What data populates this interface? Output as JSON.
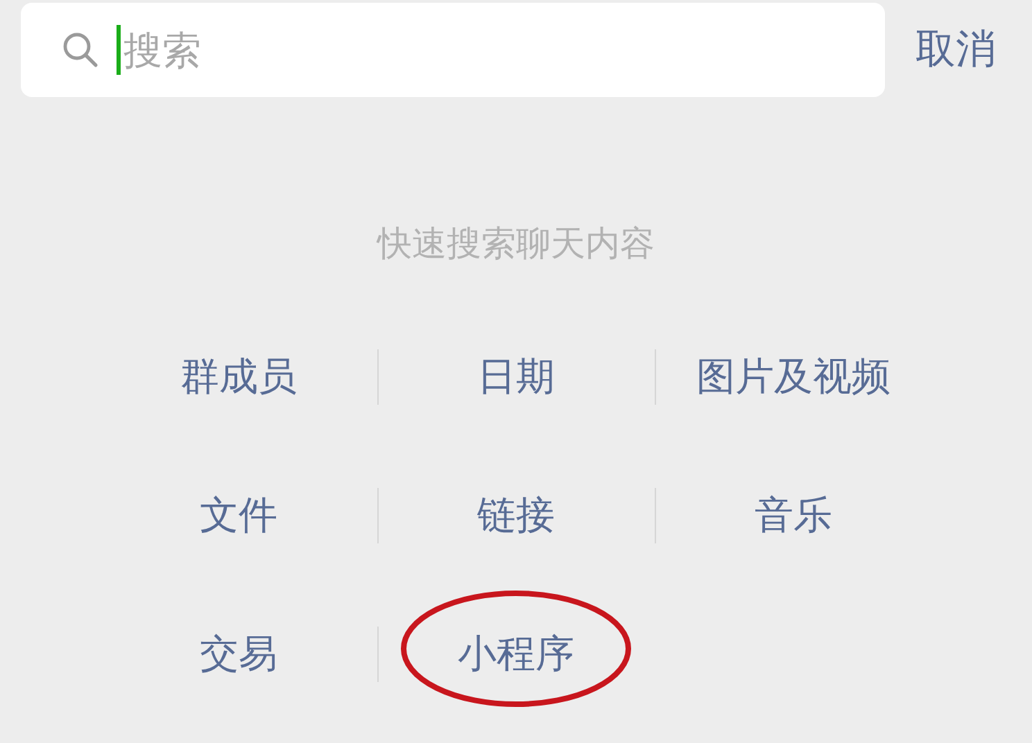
{
  "search": {
    "placeholder": "搜索",
    "focused": true
  },
  "cancel_button": "取消",
  "hint": "快速搜索聊天内容",
  "categories": [
    {
      "label": "群成员",
      "highlighted": false
    },
    {
      "label": "日期",
      "highlighted": false
    },
    {
      "label": "图片及视频",
      "highlighted": false
    },
    {
      "label": "文件",
      "highlighted": false
    },
    {
      "label": "链接",
      "highlighted": false
    },
    {
      "label": "音乐",
      "highlighted": false
    },
    {
      "label": "交易",
      "highlighted": false
    },
    {
      "label": "小程序",
      "highlighted": true
    }
  ]
}
